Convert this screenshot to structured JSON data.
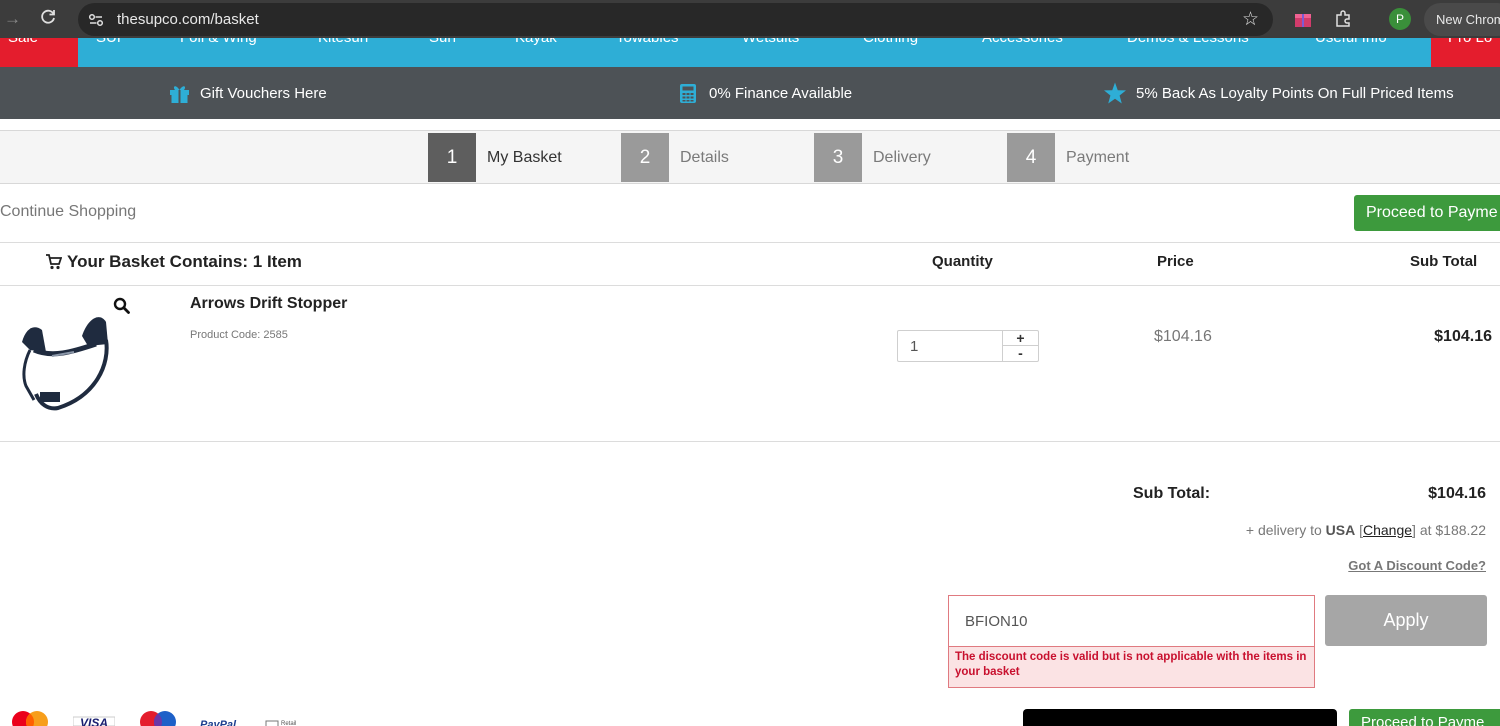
{
  "browser": {
    "url": "thesupco.com/basket",
    "new_chrome_label": "New Chrom",
    "profile_initial": "P"
  },
  "category_nav": {
    "items": [
      "Sale",
      "SUP",
      "Foil & Wing",
      "Kitesurf",
      "Surf",
      "Kayak",
      "Towables",
      "Wetsuits",
      "Clothing",
      "Accessories",
      "Demos & Lessons",
      "Useful Info",
      "Pro Lo"
    ]
  },
  "benefits": {
    "gift": "Gift Vouchers Here",
    "finance": "0% Finance Available",
    "loyalty": "5% Back As Loyalty Points On Full Priced Items"
  },
  "steps": [
    {
      "num": "1",
      "label": "My Basket"
    },
    {
      "num": "2",
      "label": "Details"
    },
    {
      "num": "3",
      "label": "Delivery"
    },
    {
      "num": "4",
      "label": "Payment"
    }
  ],
  "actions": {
    "continue_shopping": "Continue Shopping",
    "proceed_top": "Proceed to Payme",
    "proceed_bottom": "Proceed to Payme"
  },
  "basket": {
    "heading": "Your Basket Contains: 1 Item",
    "columns": {
      "quantity": "Quantity",
      "price": "Price",
      "subtotal": "Sub Total"
    },
    "items": [
      {
        "name": "Arrows Drift Stopper",
        "code": "Product Code: 2585",
        "quantity": "1",
        "price": "$104.16",
        "subtotal": "$104.16"
      }
    ]
  },
  "summary": {
    "subtotal_label": "Sub Total:",
    "subtotal_value": "$104.16",
    "delivery_prefix": "+ delivery to",
    "delivery_country": "USA",
    "delivery_change": "Change",
    "delivery_suffix": "at $188.22",
    "discount_link": "Got A Discount Code?"
  },
  "discount": {
    "code_value": "BFION10",
    "error": "The discount code is valid but is not applicable with the items in your basket",
    "apply_label": "Apply"
  },
  "colors": {
    "nav_blue": "#2eaed6",
    "sale_red": "#e41d2d",
    "benefits_bg": "#4d5256",
    "proceed_green": "#3d9a3d",
    "error_red": "#c8102e"
  }
}
